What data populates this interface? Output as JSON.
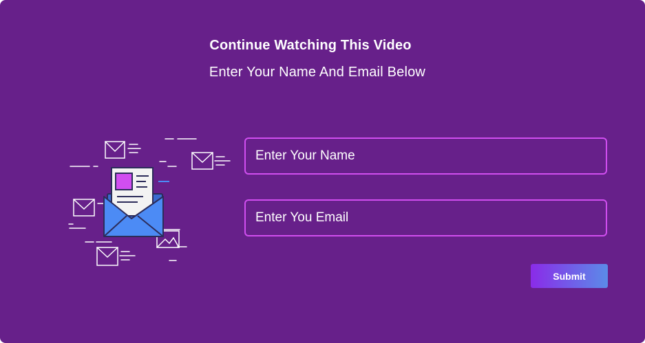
{
  "header": {
    "title": "Continue Watching This Video",
    "subtitle": "Enter Your Name And Email Below"
  },
  "form": {
    "name_placeholder": "Enter Your Name",
    "email_placeholder": "Enter You Email",
    "submit_label": "Submit"
  },
  "illustration": {
    "icon": "email-newsletter-icon"
  },
  "colors": {
    "background": "#67208a",
    "field_border": "#d14ef0",
    "button_gradient_start": "#8a2be8",
    "button_gradient_end": "#5b8be8",
    "envelope_blue": "#4c8bf5",
    "accent_magenta": "#d14ef0"
  }
}
